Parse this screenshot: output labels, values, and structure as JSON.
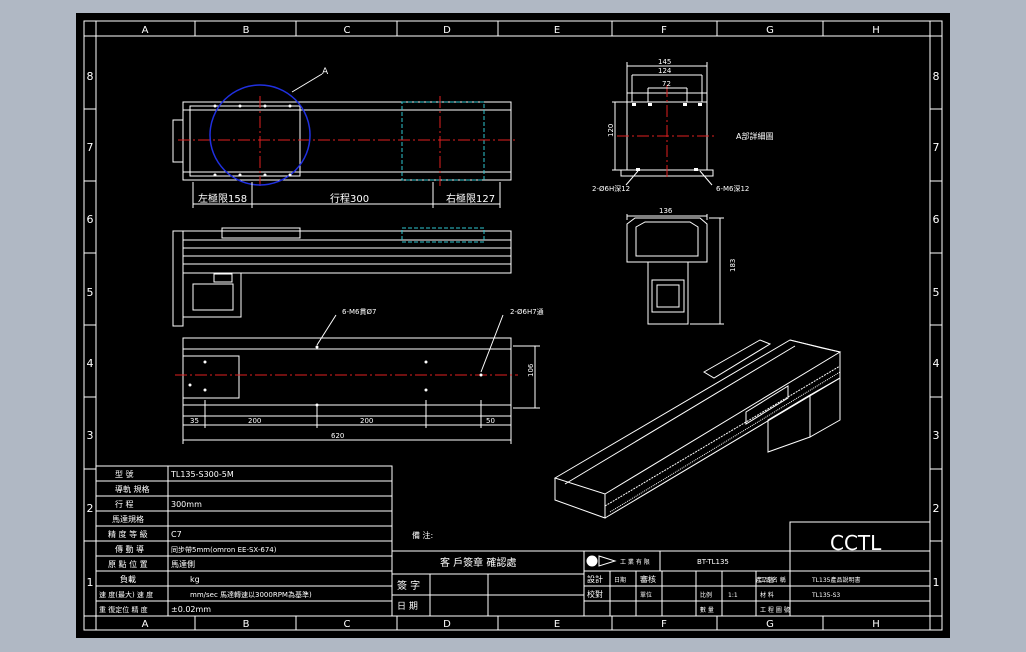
{
  "columns": [
    "A",
    "B",
    "C",
    "D",
    "E",
    "F",
    "G",
    "H"
  ],
  "rows": [
    "8",
    "7",
    "6",
    "5",
    "4",
    "3",
    "2",
    "1"
  ],
  "top_view": {
    "detail_callout": "A",
    "left_limit": "左極限158",
    "stroke": "行程300",
    "right_limit": "右極限127"
  },
  "end_view": {
    "dims": [
      "145",
      "124",
      "72"
    ],
    "height": "120",
    "detail_label": "A部詳細圖",
    "hole_left": "2-Ø6H深12",
    "hole_right": "6-M6深12"
  },
  "motor_view": {
    "width": "136",
    "height": "183"
  },
  "bottom_view": {
    "hole_top_left": "6-M6貫Ø7",
    "hole_top_right": "2-Ø6H7通",
    "height": "106",
    "spacings": [
      "35",
      "200",
      "200",
      "50"
    ],
    "total": "620"
  },
  "spec_table": {
    "rows": [
      {
        "label": "型  號",
        "value": "TL135-S300-5M"
      },
      {
        "label": "導軌 規格",
        "value": ""
      },
      {
        "label": "行  程",
        "value": "300mm"
      },
      {
        "label": "馬達規格",
        "value": ""
      },
      {
        "label": "精 度 等 級",
        "value": "C7"
      },
      {
        "label": "傳 動 導",
        "value": "同步帶5mm(omron EE-SX-674)"
      },
      {
        "label": "原 點 位 置",
        "value": "馬達側"
      },
      {
        "label": "負載",
        "value": "kg"
      },
      {
        "label": "速 度(最大) 速 度",
        "value": "mm/sec 馬達轉速以3000RPM為基準)"
      },
      {
        "label": "重 復定位 精 度",
        "value": "±0.02mm"
      }
    ]
  },
  "notes_label": "備 注:",
  "customer_confirm": "客 戶簽章 確認處",
  "sign_label": "簽 字",
  "date_label": "日 期",
  "title_block": {
    "company": "工 業 有 限",
    "drawing_no": "BT-TL135",
    "logo_text": "CCTL",
    "cells": [
      "設計",
      "日期",
      "審核",
      "比例",
      "校對",
      "1:1",
      "工 藝",
      "單位",
      "材 料",
      "數 量",
      "產 品 名 稱",
      "工 程 圖 號"
    ],
    "product_name": "TL135產品說明書",
    "code": "TL135-S3"
  }
}
